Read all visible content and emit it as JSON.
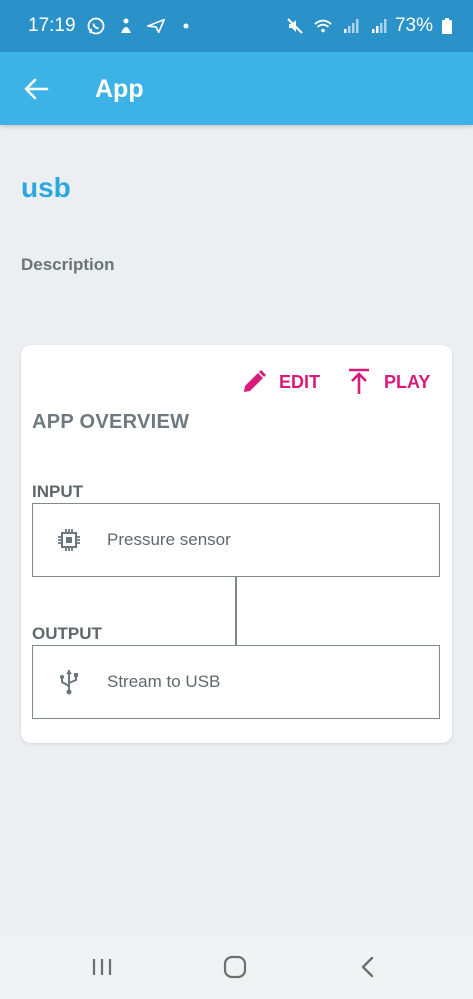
{
  "status_bar": {
    "time": "17:19",
    "battery_percent": "73%",
    "icons": [
      "whatsapp-icon",
      "notification-icon",
      "send-icon",
      "dot-icon",
      "mute-icon",
      "wifi-icon",
      "signal-icon",
      "signal-icon",
      "battery-icon"
    ]
  },
  "app_bar": {
    "title": "App",
    "back_icon": "arrow-left-icon"
  },
  "page": {
    "title": "usb",
    "description_label": "Description"
  },
  "card": {
    "edit_label": "EDIT",
    "play_label": "PLAY",
    "overview_title": "APP OVERVIEW",
    "input": {
      "label": "INPUT",
      "node_label": "Pressure sensor",
      "icon": "chip-icon"
    },
    "output": {
      "label": "OUTPUT",
      "node_label": "Stream to USB",
      "icon": "usb-icon"
    }
  },
  "colors": {
    "status_bar": "#2a92c8",
    "app_bar": "#3cb2e6",
    "accent_title": "#2aa8de",
    "action": "#d81b7a",
    "background": "#ebeff2"
  },
  "nav_bar": {
    "icons": [
      "recents-icon",
      "home-icon",
      "back-icon"
    ]
  }
}
